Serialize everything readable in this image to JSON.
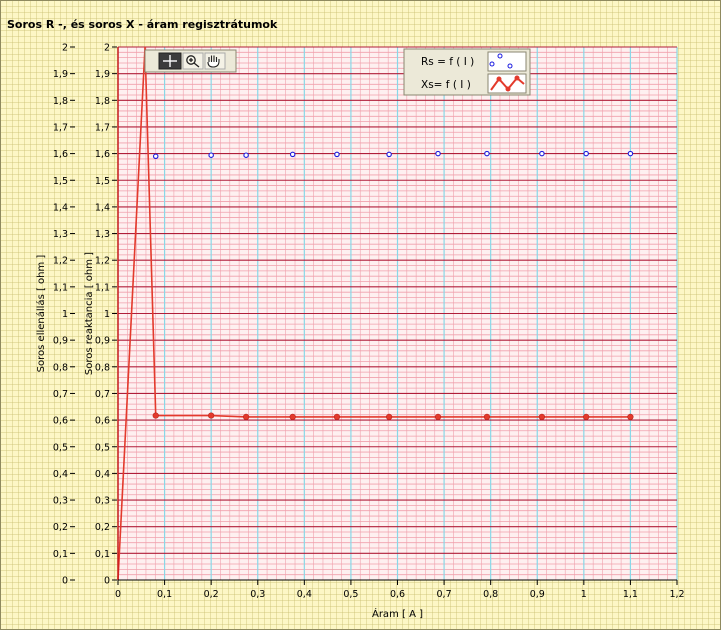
{
  "window": {
    "title": "Soros R -, és soros X - áram regisztrátumok"
  },
  "toolbar": {
    "items": [
      {
        "icon": "crosshair-icon",
        "name": "cursor-tool-button"
      },
      {
        "icon": "zoom-icon",
        "name": "zoom-tool-button"
      },
      {
        "icon": "hand-icon",
        "name": "pan-tool-button"
      }
    ]
  },
  "chart_data": {
    "type": "scatter",
    "title": "Soros R -, és soros X - áram regisztrátumok",
    "xlabel": "Áram   [ A ]",
    "ylabel_left": "Soros ellenállás  [ ohm ]",
    "ylabel_right": "Soros reaktancia   [ ohm ]",
    "xlim": [
      0,
      1.2
    ],
    "ylim": [
      0,
      2
    ],
    "x_ticks": [
      "0",
      "0,1",
      "0,2",
      "0,3",
      "0,4",
      "0,5",
      "0,6",
      "0,7",
      "0,8",
      "0,9",
      "1",
      "1,1",
      "1,2"
    ],
    "y_ticks": [
      "0",
      "0,1",
      "0,2",
      "0,3",
      "0,4",
      "0,5",
      "0,6",
      "0,7",
      "0,8",
      "0,9",
      "1",
      "1,1",
      "1,2",
      "1,3",
      "1,4",
      "1,5",
      "1,6",
      "1,7",
      "1,8",
      "1,9",
      "2"
    ],
    "grid": true,
    "legend_position": "top-right",
    "series": [
      {
        "name": "Rs = f ( I )",
        "style": "hollow-circle-markers",
        "color": "#1a1ae0",
        "x": [
          0.081,
          0.2,
          0.275,
          0.375,
          0.47,
          0.582,
          0.687,
          0.792,
          0.91,
          1.005,
          1.1
        ],
        "y": [
          1.59,
          1.594,
          1.594,
          1.597,
          1.597,
          1.597,
          1.6,
          1.6,
          1.6,
          1.6,
          1.6
        ]
      },
      {
        "name": "Xs= f ( I )",
        "style": "line-with-filled-markers",
        "color": "#e33a2c",
        "x": [
          0.0,
          0.058,
          0.081,
          0.2,
          0.275,
          0.375,
          0.47,
          0.582,
          0.687,
          0.792,
          0.91,
          1.005,
          1.1
        ],
        "y": [
          0.0,
          2.0,
          0.617,
          0.617,
          0.612,
          0.612,
          0.612,
          0.612,
          0.612,
          0.612,
          0.612,
          0.612,
          0.612
        ],
        "markers_from_index": 2
      }
    ],
    "colors": {
      "plot_background": "#fef0f0",
      "grid_minor": "#f0a0ac",
      "grid_major_h": "#b01e3a",
      "grid_major_v": "#88d8e8",
      "left_axis_line": "#cc1a1a"
    }
  }
}
